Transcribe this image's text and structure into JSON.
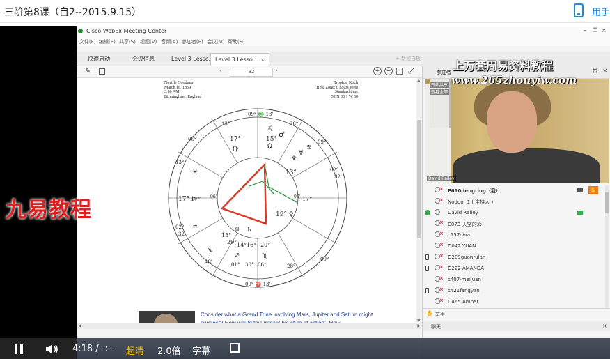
{
  "page": {
    "title": "三阶第8课（自2--2015.9.15）",
    "user_label": "用手"
  },
  "webex": {
    "window_title": "Cisco WebEx Meeting Center",
    "menu": [
      "文件(F)",
      "编辑(E)",
      "共享(S)",
      "视图(V)",
      "音频(A)",
      "参加者(P)",
      "会议(M)",
      "帮助(H)"
    ],
    "tabs": [
      {
        "label": "快速启动"
      },
      {
        "label": "会议信息"
      },
      {
        "label": "Level 3 Lesso..."
      },
      {
        "label": "Level 3 Lesso...",
        "close": "×"
      }
    ],
    "share_label": "+ 新建白板",
    "page_indicator": "82"
  },
  "document": {
    "left_header": [
      "Neville Goodman",
      "March 18, 1869",
      "3:00 AM",
      "Birmingham, England"
    ],
    "right_header": [
      "Tropical Koch",
      "Time Zone: 0 hours West",
      "Standard time",
      "52 N 30   1 W 50"
    ],
    "caption": "Consider what a Grand Trine involving Mars, Jupiter and Saturn might suggest?  How would this impact his style of action?  How"
  },
  "chart": {
    "outer_degrees": [
      "09° ♎ 13'",
      "13°",
      "28°",
      "06°",
      "09°",
      "13°",
      "02°",
      "32'",
      "17°",
      "06'",
      "02°",
      "32'",
      "48'",
      "01°",
      "30°",
      "06°",
      "28°",
      "09°",
      "09° ♈ 13'",
      "17°",
      "06'"
    ],
    "planet_labels": [
      "17°",
      "15°",
      "♂",
      "♌",
      "♍",
      "♋",
      "Ω",
      "♆",
      "♅",
      "13°",
      "17° ♃",
      "19° ♀",
      "15°",
      "29°",
      "14°",
      "16°",
      "20°",
      "♏",
      "♃",
      "♄",
      "♐",
      "♑",
      "♒",
      "♓"
    ]
  },
  "right_panel": {
    "header": "参加者",
    "camera_tag": "David Railey",
    "cam_buttons": [
      "开始共享",
      "查看全部"
    ],
    "participants": [
      {
        "name": "E610dengting（我）",
        "device": "none",
        "bold": true,
        "video": "gray",
        "hand": true
      },
      {
        "name": "Nodoor 1 ( 主持人 )",
        "device": "none"
      },
      {
        "name": "David Railey",
        "device": "green",
        "video": "green"
      },
      {
        "name": "C073-天空的彩",
        "device": "none"
      },
      {
        "name": "c157diva",
        "device": "none"
      },
      {
        "name": "D042 YUAN",
        "device": "none"
      },
      {
        "name": "D209guanrulan",
        "device": "phone"
      },
      {
        "name": "D222 AMANDA",
        "device": "phone"
      },
      {
        "name": "c407-meijuan",
        "device": "none"
      },
      {
        "name": "c421fangyan",
        "device": "phone"
      },
      {
        "name": "D465 Amber",
        "device": "none"
      }
    ],
    "raise_hand_label": "举手",
    "chat_label": "聊天"
  },
  "watermarks": {
    "top": "上万套周易资料教程",
    "url": "www.265zhouyiw.com",
    "left": "九易教程"
  },
  "player": {
    "time": "4:18 / -:--",
    "quality": "超清",
    "speed": "2.0倍",
    "subtitle": "字幕"
  },
  "colors": {
    "accent": "#1e88e5",
    "aspect_line": "#e02020",
    "hand_raise": "#f07a1b"
  }
}
